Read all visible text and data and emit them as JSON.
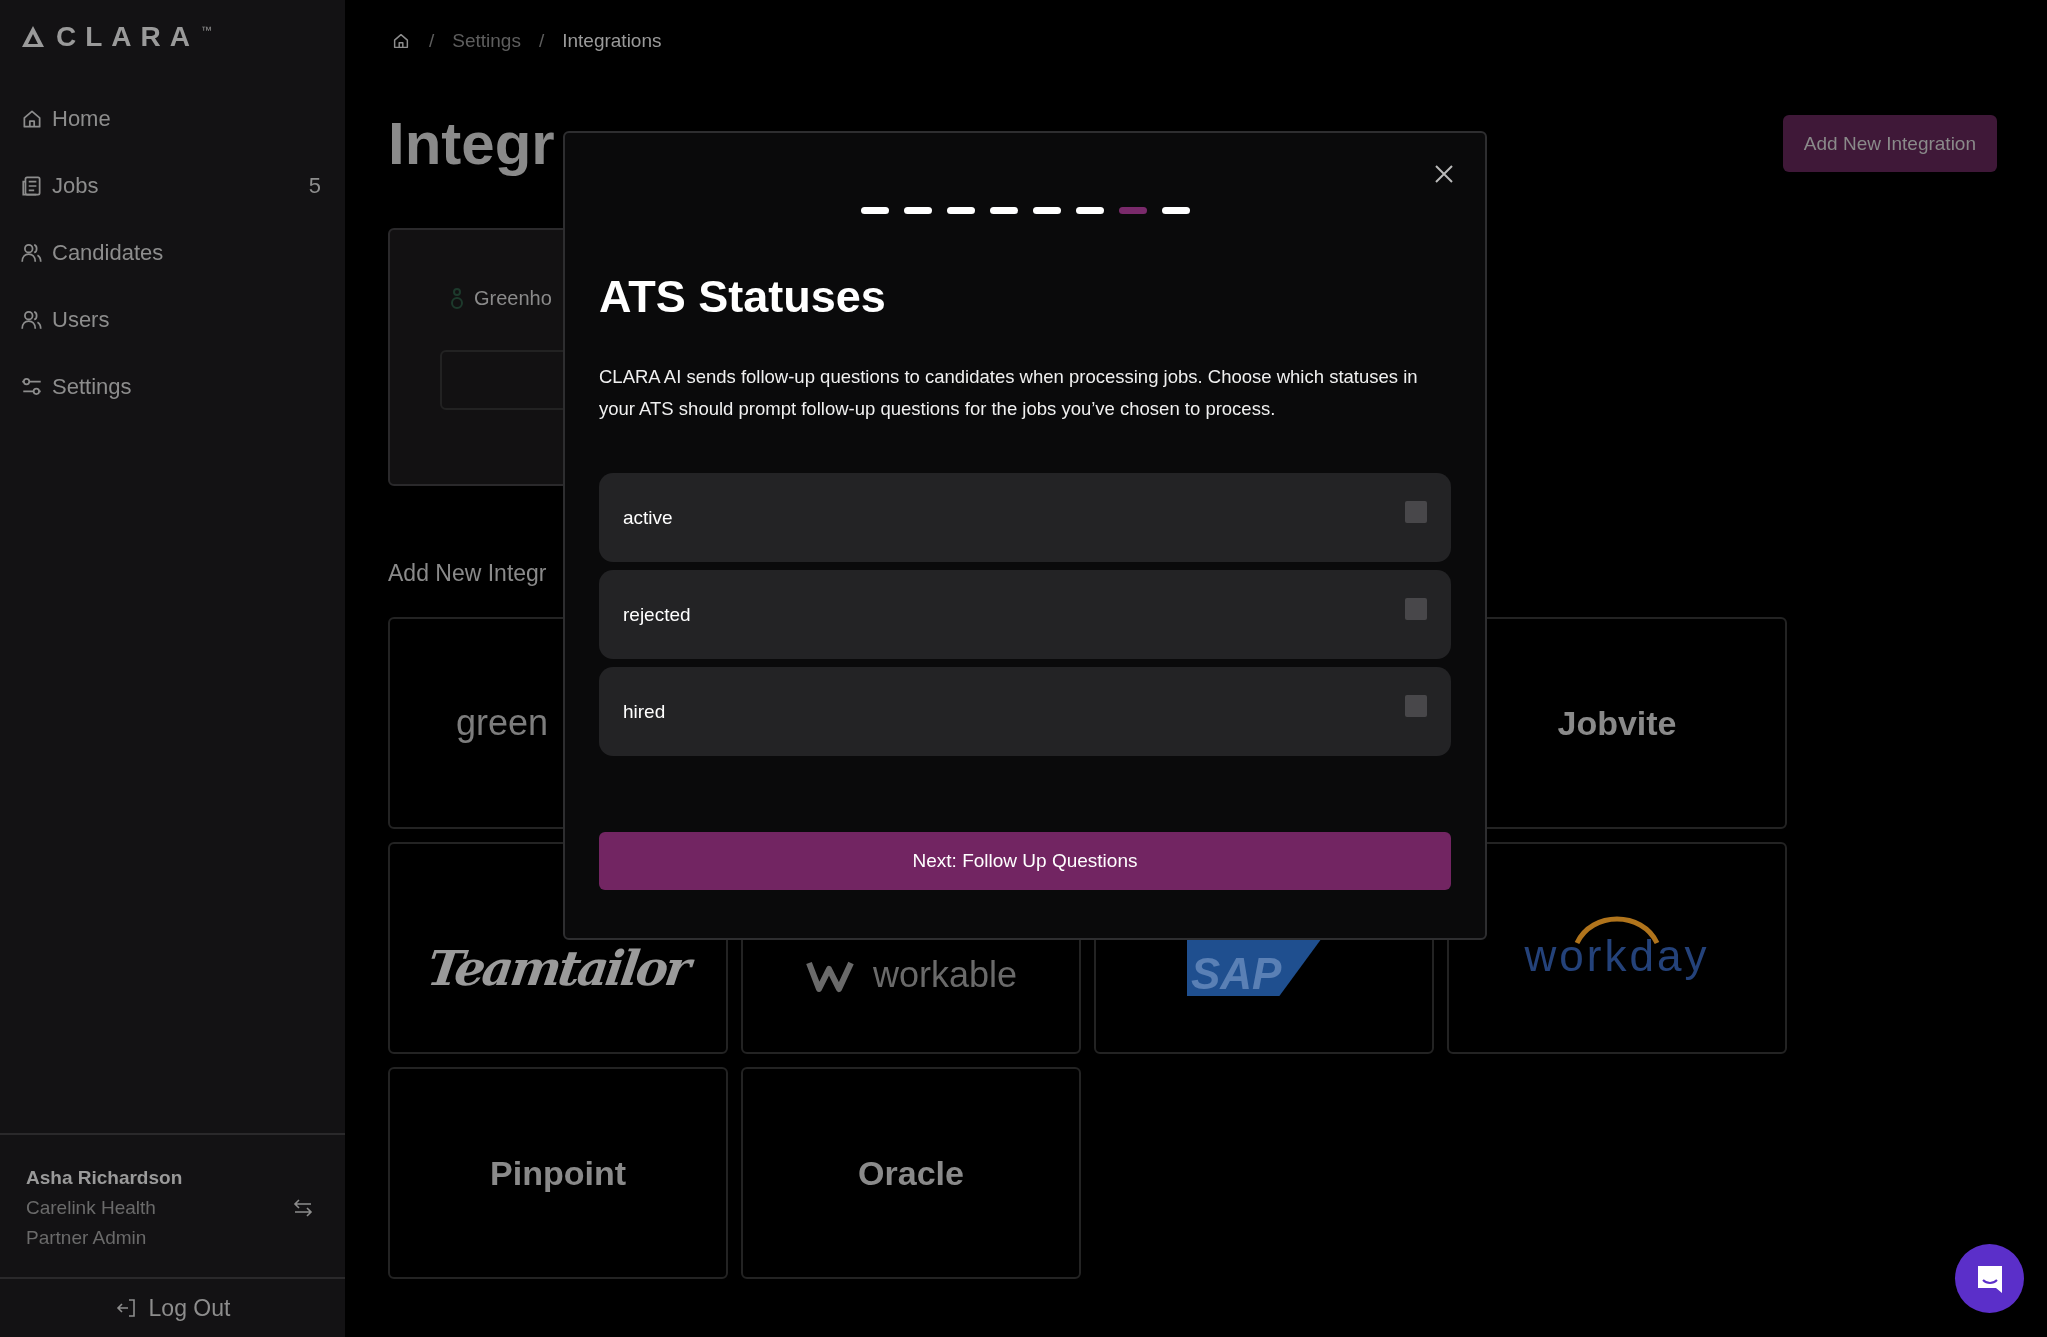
{
  "sidebar": {
    "logo": "CLARA",
    "trademark": "™",
    "items": [
      {
        "label": "Home"
      },
      {
        "label": "Jobs",
        "count": "5"
      },
      {
        "label": "Candidates"
      },
      {
        "label": "Users"
      },
      {
        "label": "Settings"
      }
    ],
    "user": {
      "name": "Asha Richardson",
      "org": "Carelink Health",
      "role": "Partner Admin"
    },
    "logout": "Log Out"
  },
  "breadcrumb": [
    "Settings",
    "Integrations"
  ],
  "breadcrumb_separator": "/",
  "page": {
    "title": "Integr",
    "add_button": "Add New Integration",
    "current": {
      "name": "Greenho"
    },
    "section_title": "Add New Integr",
    "integrations": [
      {
        "name": "green",
        "kind": "greenhouse"
      },
      {
        "name": "Jobvite",
        "kind": "wordmark"
      },
      {
        "name": "Teamtailor",
        "kind": "script"
      },
      {
        "name": "workable",
        "kind": "workable"
      },
      {
        "name": "SAP",
        "kind": "sap"
      },
      {
        "name": "workday",
        "kind": "workday"
      },
      {
        "name": "Pinpoint",
        "kind": "wordmark"
      },
      {
        "name": "Oracle",
        "kind": "wordmark"
      }
    ]
  },
  "modal": {
    "steps": [
      {
        "selected": false
      },
      {
        "selected": false
      },
      {
        "selected": false
      },
      {
        "selected": false
      },
      {
        "selected": false
      },
      {
        "selected": false
      },
      {
        "selected": true
      },
      {
        "selected": false
      }
    ],
    "title": "ATS Statuses",
    "description": "CLARA AI sends follow-up questions to candidates when processing jobs. Choose which statuses in your ATS should prompt follow-up questions for the jobs you’ve chosen to process.",
    "options": [
      {
        "label": "active",
        "checked": false
      },
      {
        "label": "rejected",
        "checked": false
      },
      {
        "label": "hired",
        "checked": false
      }
    ],
    "next_button": "Next: Follow Up Questions"
  }
}
